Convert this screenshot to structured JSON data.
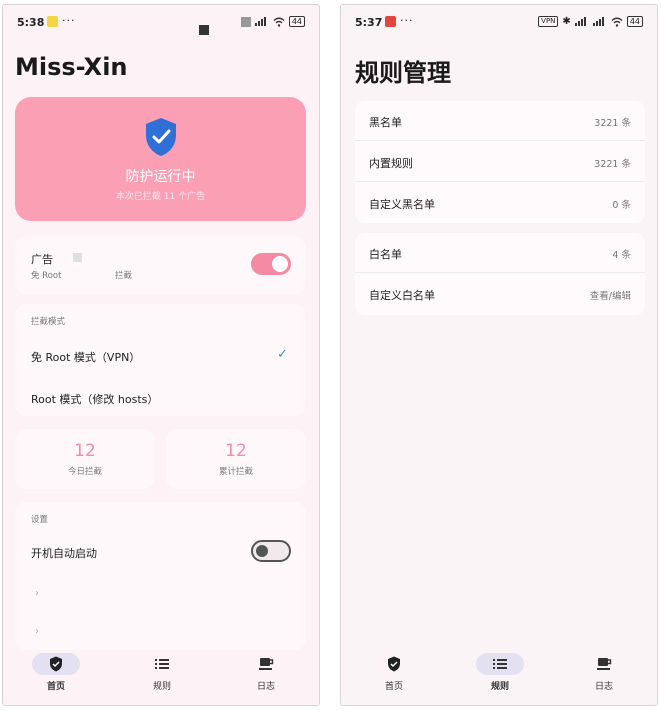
{
  "left_screen": {
    "status": {
      "time": "5:38",
      "dots": "···",
      "battery": "44"
    },
    "app_title": "Miss-Xin",
    "hero": {
      "status_text": "防护运行中",
      "sub_text": "本次已拦截 11 个广告"
    },
    "ad_card": {
      "title": "广告",
      "sub_left": "免 Root",
      "sub_right": "拦截",
      "toggle_on": true
    },
    "mode_card": {
      "header": "拦截模式",
      "options": [
        {
          "label": "免 Root 模式（VPN）",
          "selected": true
        },
        {
          "label": "Root 模式（修改 hosts）",
          "selected": false
        }
      ]
    },
    "stats": [
      {
        "value": "12",
        "label": "今日拦截"
      },
      {
        "value": "12",
        "label": "累计拦截"
      }
    ],
    "settings_card": {
      "header": "设置",
      "autostart_label": "开机自动启动",
      "autostart_on": false,
      "chevron": "›"
    },
    "nav": [
      {
        "label": "首页",
        "icon": "shield-check-icon",
        "active": true
      },
      {
        "label": "规则",
        "icon": "list-icon",
        "active": false
      },
      {
        "label": "日志",
        "icon": "coffee-cup-icon",
        "active": false
      }
    ]
  },
  "right_screen": {
    "status": {
      "time": "5:37",
      "dots": "···",
      "battery": "44",
      "vpn": "VPN"
    },
    "page_title": "规则管理",
    "blacklist_card": [
      {
        "name": "黑名单",
        "value": "3221 条"
      },
      {
        "name": "内置规则",
        "value": "3221 条"
      },
      {
        "name": "自定义黑名单",
        "value": "0 条"
      }
    ],
    "whitelist_card": [
      {
        "name": "白名单",
        "value": "4 条"
      },
      {
        "name": "自定义白名单",
        "value": "查看/编辑"
      }
    ],
    "nav": [
      {
        "label": "首页",
        "icon": "shield-check-icon",
        "active": false
      },
      {
        "label": "规则",
        "icon": "list-icon",
        "active": true
      },
      {
        "label": "日志",
        "icon": "coffee-cup-icon",
        "active": false
      }
    ]
  },
  "colors": {
    "accent_pink": "#fb9fb4",
    "toggle_pink": "#f48aa4",
    "check_blue": "#4a8fd6",
    "shield_blue": "#2f6fd6"
  }
}
